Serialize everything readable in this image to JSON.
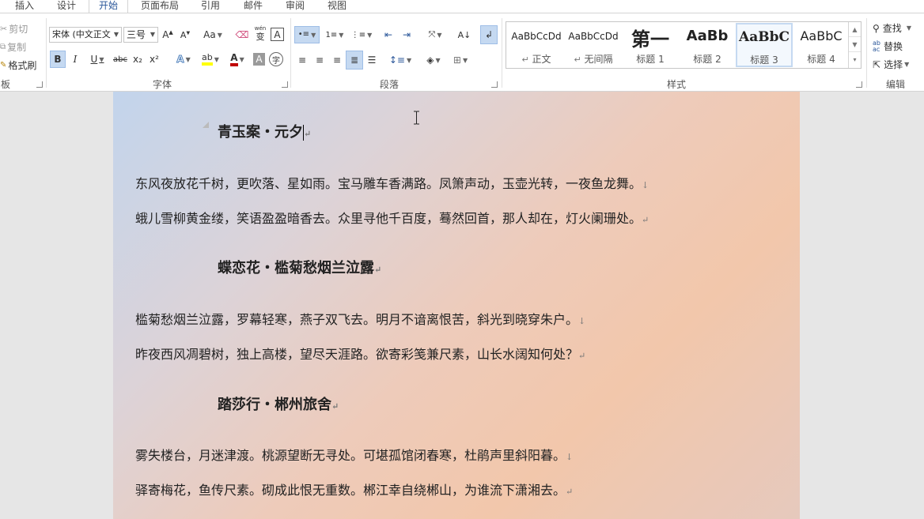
{
  "tabs": [
    {
      "label": "插入",
      "active": false
    },
    {
      "label": "设计",
      "active": false
    },
    {
      "label": "开始",
      "active": true
    },
    {
      "label": "页面布局",
      "active": false
    },
    {
      "label": "引用",
      "active": false
    },
    {
      "label": "邮件",
      "active": false
    },
    {
      "label": "审阅",
      "active": false
    },
    {
      "label": "视图",
      "active": false
    }
  ],
  "clipboard": {
    "cut": "剪切",
    "copy": "复制",
    "format_painter": "格式刷",
    "group_label": "板"
  },
  "font": {
    "font_name": "宋体 (中文正文",
    "font_size": "三号",
    "change_case": "Aa",
    "phonetic_top": "wén",
    "phonetic_char": "变",
    "border_char": "A",
    "bold": "B",
    "italic": "I",
    "underline": "U",
    "strikethrough": "abc",
    "subscript": "x₂",
    "superscript": "x²",
    "text_effect": "A",
    "font_color": "A",
    "char_shading": "A",
    "enclose_char": "字",
    "group_label": "字体"
  },
  "paragraph": {
    "group_label": "段落"
  },
  "styles": {
    "items": [
      {
        "sample": "AaBbCcDd",
        "name": "正文",
        "mark": "↵"
      },
      {
        "sample": "AaBbCcDd",
        "name": "无间隔",
        "mark": "↵"
      },
      {
        "sample": "第一",
        "name": "标题 1",
        "mark": ""
      },
      {
        "sample": "AaBb",
        "name": "标题 2",
        "mark": ""
      },
      {
        "sample": "AaBbC",
        "name": "标题 3",
        "mark": ""
      },
      {
        "sample": "AaBbC",
        "name": "标题 4",
        "mark": ""
      }
    ],
    "group_label": "样式"
  },
  "editing": {
    "find": "查找",
    "replace": "替换",
    "select": "选择",
    "group_label": "编辑",
    "replace_icon_top": "ab",
    "replace_icon_bottom": "ac"
  },
  "document": {
    "poems": [
      {
        "title": "青玉案・元夕",
        "lines": [
          {
            "text": "东风夜放花千树，更吹落、星如雨。宝马雕车香满路。凤箫声动，玉壶光转，一夜鱼龙舞。",
            "mark": "↓"
          },
          {
            "text": "蛾儿雪柳黄金缕，笑语盈盈暗香去。众里寻他千百度，蓦然回首，那人却在，灯火阑珊处。",
            "mark": "↵"
          }
        ]
      },
      {
        "title": "蝶恋花・槛菊愁烟兰泣露",
        "lines": [
          {
            "text": "槛菊愁烟兰泣露，罗幕轻寒，燕子双飞去。明月不谙离恨苦，斜光到晓穿朱户。",
            "mark": "↓"
          },
          {
            "text": "昨夜西风凋碧树，独上高楼，望尽天涯路。欲寄彩笺兼尺素，山长水阔知何处？",
            "mark": "↵"
          }
        ]
      },
      {
        "title": "踏莎行・郴州旅舍",
        "lines": [
          {
            "text": "雾失楼台，月迷津渡。桃源望断无寻处。可堪孤馆闭春寒，杜鹃声里斜阳暮。",
            "mark": "↓"
          },
          {
            "text": "驿寄梅花，鱼传尺素。砌成此恨无重数。郴江幸自绕郴山，为谁流下潇湘去。",
            "mark": "↵"
          }
        ]
      }
    ],
    "title_mark": "↵"
  },
  "colors": {
    "accent": "#2b579a",
    "highlight": "#ffff00",
    "font_color": "#c00000",
    "selected_button": "#c5d9f1"
  }
}
